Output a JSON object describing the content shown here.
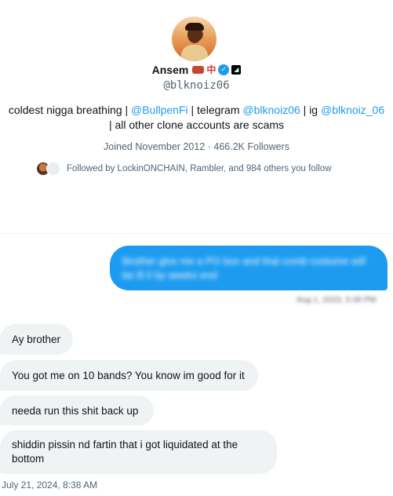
{
  "profile": {
    "name": "Ansem",
    "name_badges": [
      "cow-emoji",
      "mahjong-red-dragon",
      "verified-badge",
      "affiliate-badge"
    ],
    "handle": "@blknoiz06",
    "bio_line1_prefix": "coldest nigga breathing | ",
    "bio_link1": "@BullpenFi",
    "bio_mid1": " | telegram ",
    "bio_link2": "@blknoiz06",
    "bio_mid2": " | ig ",
    "bio_link3": "@blknoiz_06",
    "bio_line2": "| all other clone accounts are scams",
    "joined": "Joined November 2012",
    "separator": " · ",
    "followers": "466.2K Followers",
    "followed_by": "Followed by LockinONCHAIN, Rambler, and 984 others you follow"
  },
  "conversation": {
    "sent_message": "Brother give me a PO box and that comb costume will be ill 0 by weeks end",
    "sent_time": "Aug 1, 2023, 5:48 PM",
    "received": [
      "Ay brother",
      "You got me on 10 bands? You know im good for it",
      "needa run this shit back up",
      "shiddin pissin nd fartin that i got liquidated at the bottom"
    ],
    "received_time": "July 21, 2024, 8:38 AM"
  },
  "colors": {
    "accent": "#1d9bf0",
    "secondary_text": "#536471",
    "received_bubble": "#eff3f4"
  }
}
